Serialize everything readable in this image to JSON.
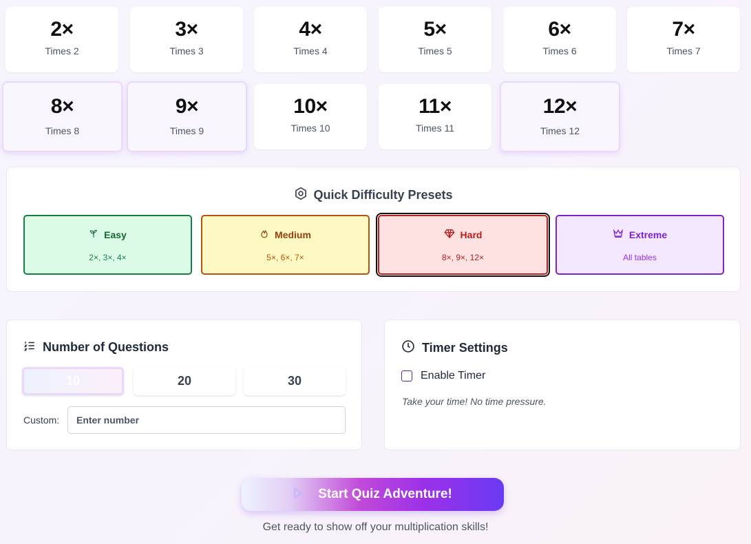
{
  "tables": [
    {
      "num": "2×",
      "label": "Times 2"
    },
    {
      "num": "3×",
      "label": "Times 3"
    },
    {
      "num": "4×",
      "label": "Times 4"
    },
    {
      "num": "5×",
      "label": "Times 5"
    },
    {
      "num": "6×",
      "label": "Times 6"
    },
    {
      "num": "7×",
      "label": "Times 7"
    },
    {
      "num": "8×",
      "label": "Times 8",
      "selected": true
    },
    {
      "num": "9×",
      "label": "Times 9",
      "selected": true
    },
    {
      "num": "10×",
      "label": "Times 10"
    },
    {
      "num": "11×",
      "label": "Times 11"
    },
    {
      "num": "12×",
      "label": "Times 12",
      "selected": true
    }
  ],
  "presets": {
    "title": "Quick Difficulty Presets",
    "items": [
      {
        "name": "Easy",
        "sub": "2×, 3×, 4×",
        "icon": "sprout-icon"
      },
      {
        "name": "Medium",
        "sub": "5×, 6×, 7×",
        "icon": "flame-icon"
      },
      {
        "name": "Hard",
        "sub": "8×, 9×, 12×",
        "icon": "gem-icon",
        "selected": true
      },
      {
        "name": "Extreme",
        "sub": "All tables",
        "icon": "crown-icon"
      }
    ]
  },
  "questions": {
    "title": "Number of Questions",
    "options": [
      "10",
      "20",
      "30"
    ],
    "selected": "10",
    "custom_label": "Custom:",
    "custom_placeholder": "Enter number"
  },
  "timer": {
    "title": "Timer Settings",
    "enable_label": "Enable Timer",
    "enabled": false,
    "note": "Take your time! No time pressure."
  },
  "start": {
    "label": "Start Quiz Adventure!",
    "subtitle": "Get ready to show off your multiplication skills!"
  },
  "colors": {
    "easy": "#15803d",
    "medium": "#b45309",
    "hard": "#b91c1c",
    "extreme": "#7e22ce",
    "accent": "#9333ea"
  }
}
